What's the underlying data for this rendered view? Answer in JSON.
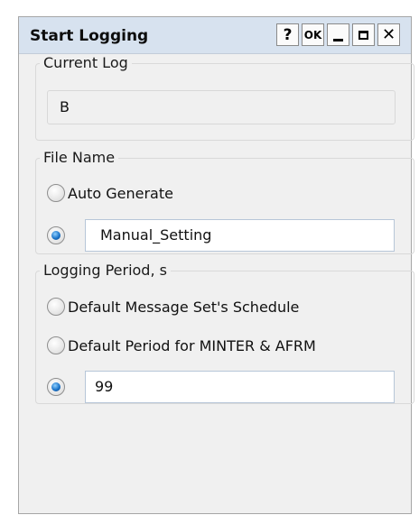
{
  "window": {
    "title": "Start Logging",
    "buttons": {
      "help": "?",
      "ok": "OK"
    }
  },
  "current_log": {
    "legend": "Current Log",
    "value": "B"
  },
  "file_name": {
    "legend": "File Name",
    "options": [
      {
        "label": "Auto Generate",
        "checked": false
      },
      {
        "label": "",
        "checked": true
      }
    ],
    "manual_value": "Manual_Setting"
  },
  "logging_period": {
    "legend": "Logging Period, s",
    "options": [
      {
        "label": "Default Message Set's Schedule",
        "checked": false
      },
      {
        "label": "Default Period for MINTER & AFRM",
        "checked": false
      },
      {
        "label": "",
        "checked": true
      }
    ],
    "custom_value": "99"
  },
  "colors": {
    "titlebar": "#d7e2ef",
    "dialog_bg": "#f0f0f0",
    "radio_selected": "#1b74c9"
  }
}
